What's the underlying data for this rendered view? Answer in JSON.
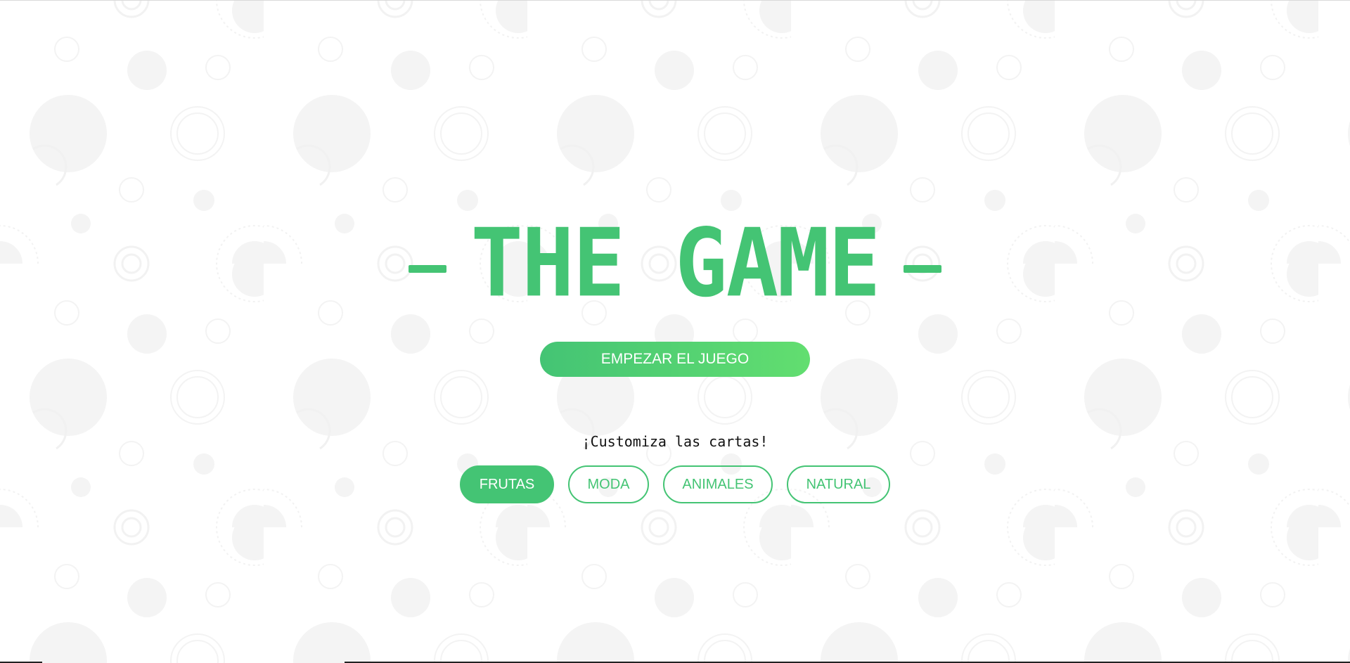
{
  "title": {
    "text": "THE GAME",
    "dash_left": "–",
    "dash_right": "–"
  },
  "start_button": {
    "label": "EMPEZAR EL JUEGO"
  },
  "customize": {
    "text": "¡Customiza las cartas!"
  },
  "themes": [
    {
      "label": "FRUTAS",
      "active": true
    },
    {
      "label": "MODA",
      "active": false
    },
    {
      "label": "ANIMALES",
      "active": false
    },
    {
      "label": "NATURAL",
      "active": false
    }
  ],
  "colors": {
    "accent": "#44c474",
    "accent_light": "#62de70",
    "pattern": "#f5f5f5",
    "text_dark": "#111111"
  }
}
